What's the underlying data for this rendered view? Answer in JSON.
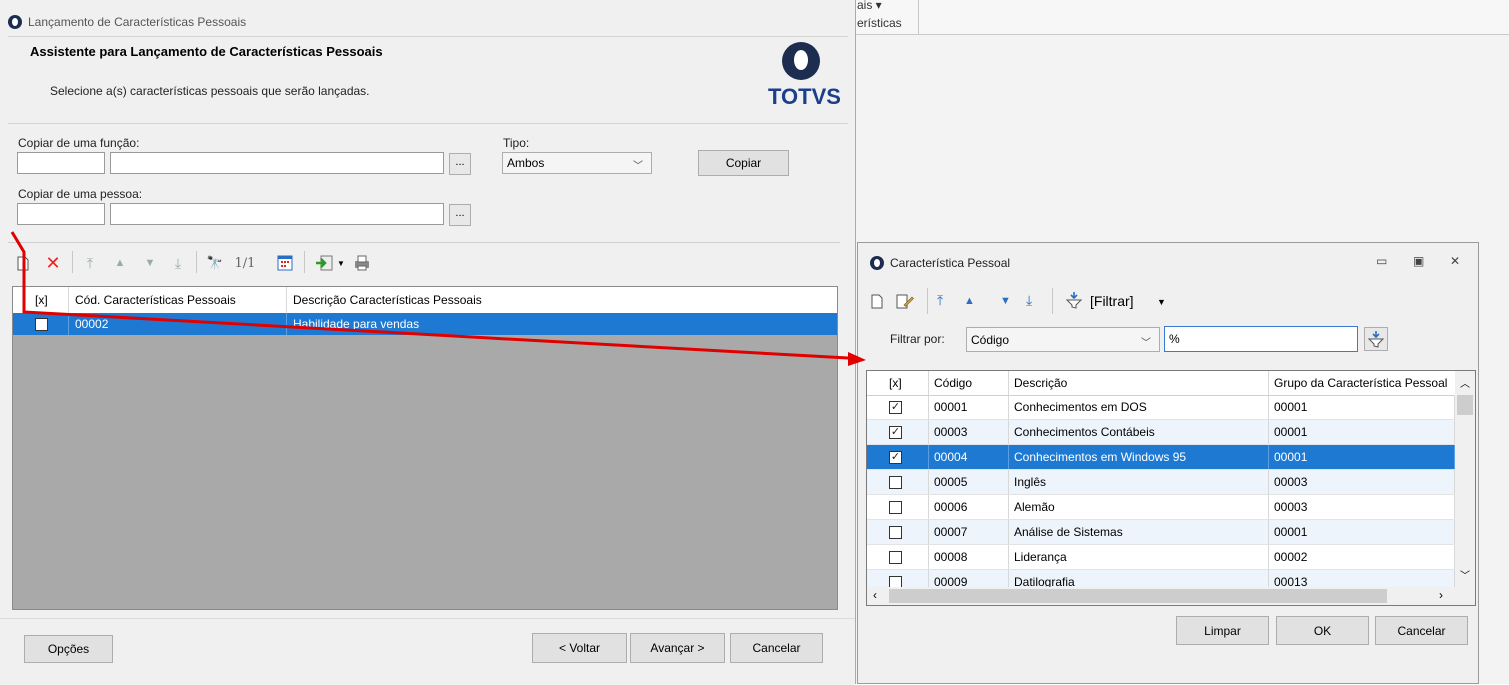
{
  "background_app": {
    "menu_fragment": "ais ▾",
    "tab_fragment": "erísticas"
  },
  "main_dialog": {
    "window_title": "Lançamento de Características Pessoais",
    "header_title": "Assistente para Lançamento de Características Pessoais",
    "header_subtitle": "Selecione a(s) características pessoais que serão lançadas.",
    "brand": "TOTVS",
    "copy_function_label": "Copiar de uma função:",
    "copy_function_code": "",
    "copy_function_desc": "",
    "browse_label": "...",
    "type_label": "Tipo:",
    "type_value": "Ambos",
    "copy_button": "Copiar",
    "copy_person_label": "Copiar de uma pessoa:",
    "copy_person_code": "",
    "copy_person_desc": "",
    "record_counter": "1/1",
    "grid": {
      "columns": [
        "[x]",
        "Cód. Características Pessoais",
        "Descrição Características Pessoais"
      ],
      "rows": [
        {
          "checked": false,
          "code": "00002",
          "description": "Habilidade para vendas"
        }
      ]
    },
    "buttons": {
      "options": "Opções",
      "back": "< Voltar",
      "next": "Avançar >",
      "cancel": "Cancelar"
    }
  },
  "lookup_dialog": {
    "window_title": "Característica Pessoal",
    "filter_menu": "[Filtrar]",
    "filter_by_label": "Filtrar por:",
    "filter_field": "Código",
    "filter_value": "%",
    "grid": {
      "columns": [
        "[x]",
        "Código",
        "Descrição",
        "Grupo da Característica Pessoal"
      ],
      "rows": [
        {
          "checked": true,
          "code": "00001",
          "description": "Conhecimentos em DOS",
          "group": "00001"
        },
        {
          "checked": true,
          "code": "00003",
          "description": "Conhecimentos Contábeis",
          "group": "00001"
        },
        {
          "checked": true,
          "code": "00004",
          "description": "Conhecimentos em Windows 95",
          "group": "00001"
        },
        {
          "checked": false,
          "code": "00005",
          "description": "Inglês",
          "group": "00003"
        },
        {
          "checked": false,
          "code": "00006",
          "description": "Alemão",
          "group": "00003"
        },
        {
          "checked": false,
          "code": "00007",
          "description": "Análise de Sistemas",
          "group": "00001"
        },
        {
          "checked": false,
          "code": "00008",
          "description": "Liderança",
          "group": "00002"
        },
        {
          "checked": false,
          "code": "00009",
          "description": "Datilografia",
          "group": "00013"
        }
      ],
      "selected_row": 2
    },
    "buttons": {
      "clear": "Limpar",
      "ok": "OK",
      "cancel": "Cancelar"
    }
  },
  "colors": {
    "selection": "#1e79d2",
    "annotation_arrow": "#e00000",
    "brand": "#1d3f8a"
  }
}
